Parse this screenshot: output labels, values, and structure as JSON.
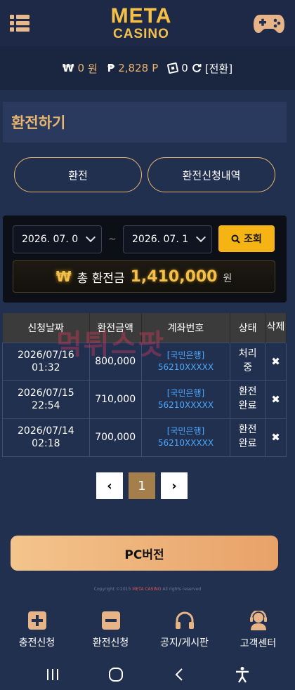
{
  "header": {
    "logo_line1": "META",
    "logo_line2": "CASINO",
    "menu_icon": "hamburger-list-icon",
    "game_icon": "gamepad-icon"
  },
  "balance": {
    "won_symbol": "₩",
    "won_value": "0",
    "won_unit": "원",
    "point_symbol": "₱",
    "point_value": "2,828",
    "point_unit": "P",
    "chip_value": "0",
    "convert_label": "[전환]"
  },
  "page": {
    "title": "환전하기"
  },
  "tabs": {
    "exchange": "환전",
    "history": "환전신청내역"
  },
  "search": {
    "date_start": "2026. 07. 0",
    "date_end": "2026. 07. 1",
    "separator": "~",
    "search_label": "조회"
  },
  "total": {
    "won_symbol": "₩",
    "label": "총 환전금",
    "amount": "1,410,000",
    "unit": "원"
  },
  "table": {
    "headers": [
      "신청날짜",
      "환전금액",
      "계좌번호",
      "상태",
      "삭제"
    ],
    "rows": [
      {
        "date": "2026/07/16",
        "time": "01:32",
        "amount": "800,000",
        "bank": "[국민은행]",
        "account": "56210XXXXX",
        "status1": "처리",
        "status2": "중",
        "delete": "✖"
      },
      {
        "date": "2026/07/15",
        "time": "22:54",
        "amount": "710,000",
        "bank": "[국민은행]",
        "account": "56210XXXXX",
        "status1": "환전",
        "status2": "완료",
        "delete": "✖"
      },
      {
        "date": "2026/07/14",
        "time": "02:18",
        "amount": "700,000",
        "bank": "[국민은행]",
        "account": "56210XXXXX",
        "status1": "환전",
        "status2": "완료",
        "delete": "✖"
      }
    ]
  },
  "watermark": "먹튀스팟",
  "pagination": {
    "prev": "‹",
    "current": "1",
    "next": "›"
  },
  "pc_button": "PC버전",
  "copyright": {
    "prefix": "Copyright ©2015 ",
    "brand": "META CASINO",
    "suffix": " All rights reserved"
  },
  "bottom_nav": [
    {
      "label": "충전신청",
      "icon": "plus-square-icon"
    },
    {
      "label": "환전신청",
      "icon": "minus-square-icon"
    },
    {
      "label": "공지/게시판",
      "icon": "headphones-icon"
    },
    {
      "label": "고객센터",
      "icon": "support-agent-icon"
    }
  ],
  "colors": {
    "background": "#22304f",
    "accent_gold": "#e8b56f",
    "search_yellow": "#f6b314",
    "link_blue": "#4aa8ff"
  }
}
